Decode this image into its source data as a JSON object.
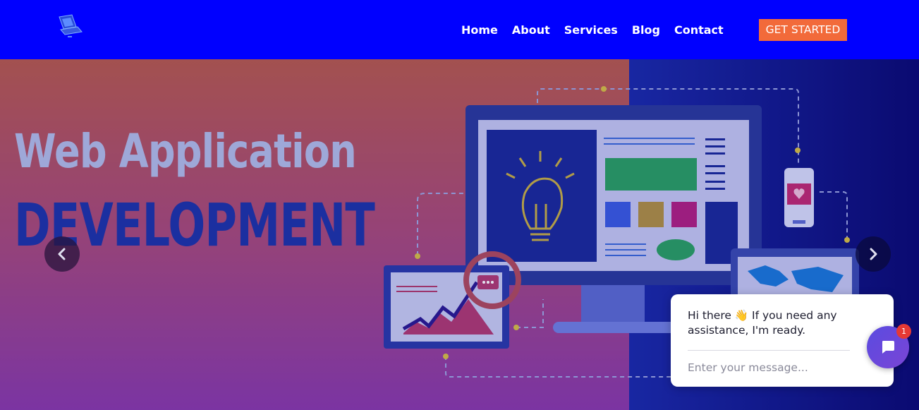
{
  "header": {
    "logo_icon": "laptop-logo-icon",
    "nav": [
      {
        "label": "Home"
      },
      {
        "label": "About"
      },
      {
        "label": "Services"
      },
      {
        "label": "Blog"
      },
      {
        "label": "Contact"
      }
    ],
    "cta_label": "GET STARTED"
  },
  "hero": {
    "title_line1": "Web Application",
    "title_line2": "DEVELOPMENT",
    "prev_icon": "chevron-left-icon",
    "next_icon": "chevron-right-icon"
  },
  "chat": {
    "greeting": "Hi there 👋 If you need any assistance, I'm ready.",
    "input_placeholder": "Enter your message...",
    "badge_count": "1",
    "launcher_icon": "chat-bubble-icon"
  },
  "colors": {
    "nav_bg": "#0000ff",
    "cta_bg": "#f26a3a",
    "launcher": "#6a48dc",
    "badge": "#e53935"
  }
}
